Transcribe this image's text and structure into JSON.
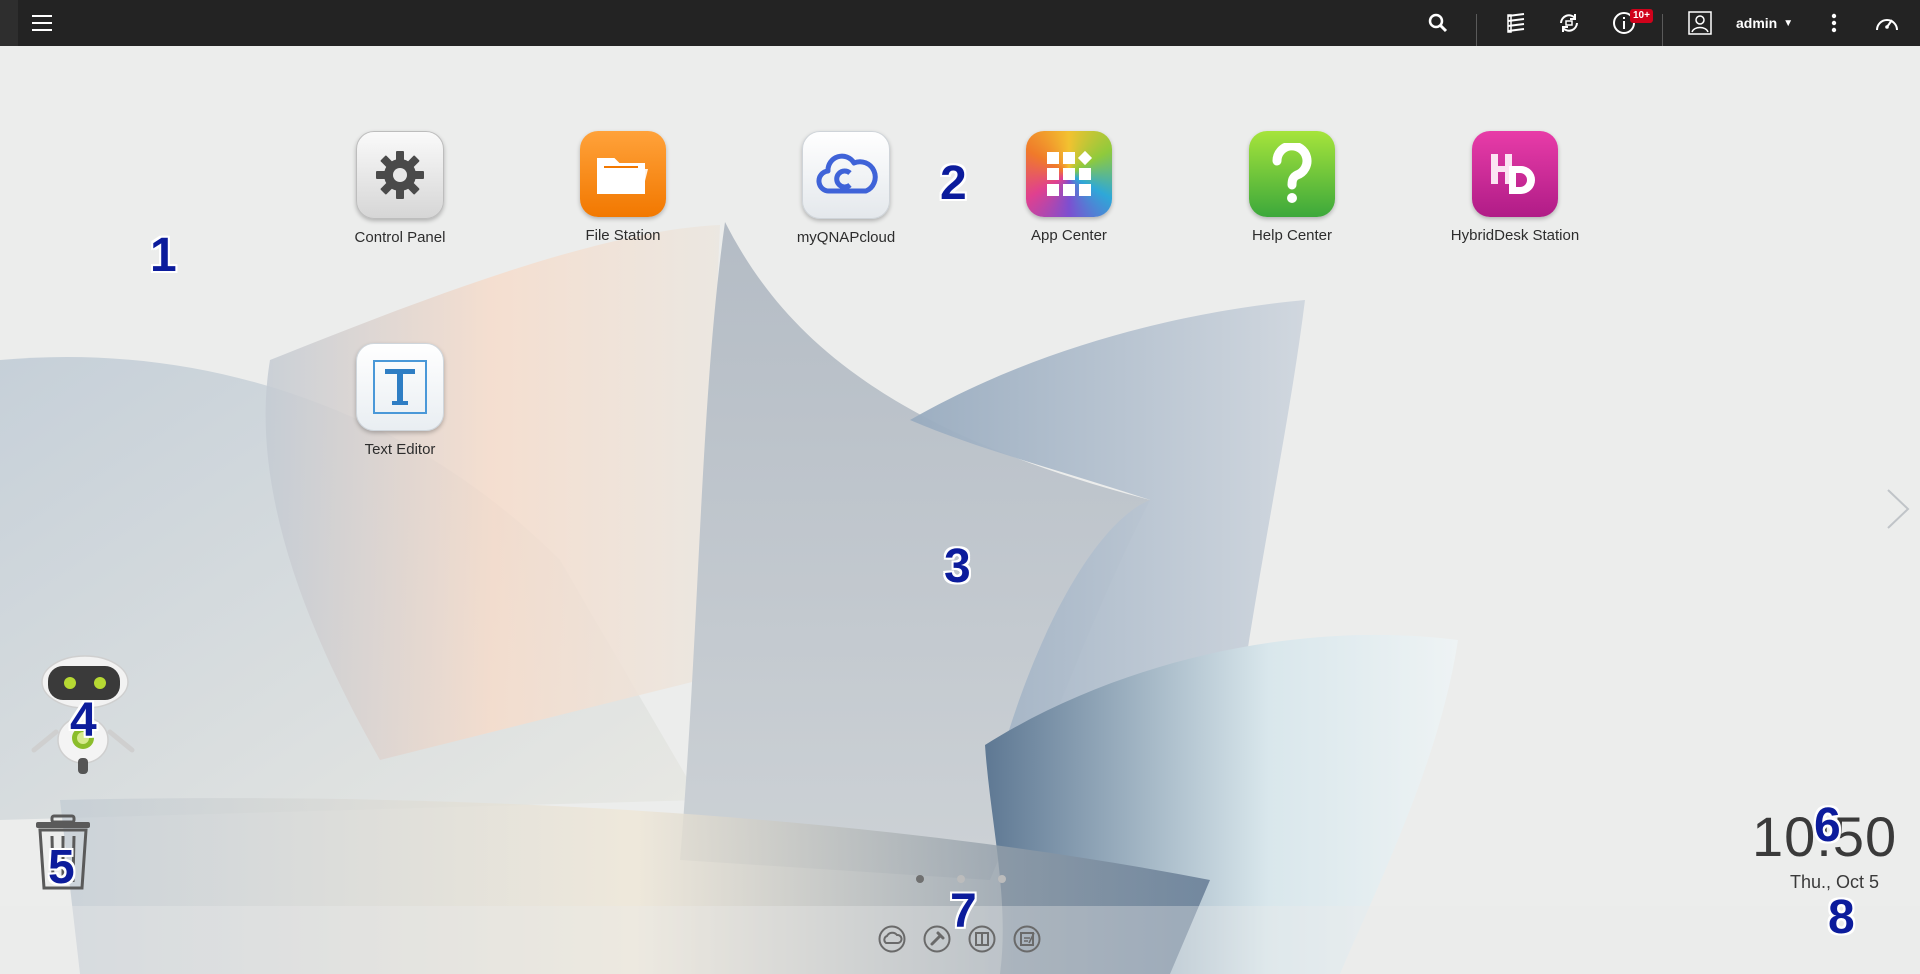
{
  "topbar": {
    "user_name": "admin",
    "notification_badge": "10+",
    "icons": [
      "menu-icon",
      "search-icon",
      "storage-icon",
      "backup-sync-icon",
      "info-notification-icon",
      "user-avatar-icon",
      "caret-down-icon",
      "more-vertical-icon",
      "dashboard-gauge-icon"
    ]
  },
  "apps": [
    {
      "label": "Control Panel",
      "icon": "gear-icon"
    },
    {
      "label": "File Station",
      "icon": "folder-icon"
    },
    {
      "label": "myQNAPcloud",
      "icon": "cloud-icon"
    },
    {
      "label": "App Center",
      "icon": "grid-icon"
    },
    {
      "label": "Help Center",
      "icon": "question-icon"
    },
    {
      "label": "HybridDesk Station",
      "icon": "hd-icon"
    },
    {
      "label": "Text Editor",
      "icon": "text-t-icon"
    }
  ],
  "markers": [
    "1",
    "2",
    "3",
    "4",
    "5",
    "6",
    "7",
    "8"
  ],
  "clock": {
    "time": "10:50",
    "date": "Thu., Oct 5"
  },
  "pagination": {
    "pages": 3,
    "current": 1
  },
  "dock": {
    "icons": [
      "myqnapcloud-dock-icon",
      "tools-dock-icon",
      "book-dock-icon",
      "notes-dock-icon"
    ]
  },
  "colors": {
    "topbar": "#232323",
    "badge": "#d0021b",
    "marker": "#0c1c9c"
  }
}
